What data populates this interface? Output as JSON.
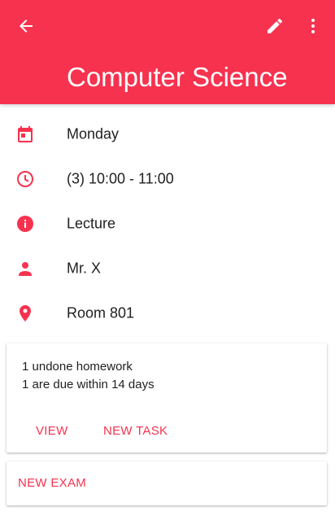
{
  "colors": {
    "accent": "#f7324f",
    "text": "#212121",
    "on_accent": "#ffffff"
  },
  "toolbar": {
    "title": "Computer Science",
    "back_icon": "arrow-back-icon",
    "edit_icon": "pencil-icon",
    "more_icon": "more-vertical-icon"
  },
  "details": [
    {
      "icon": "calendar-icon",
      "text": "Monday"
    },
    {
      "icon": "clock-icon",
      "text": "(3) 10:00 - 11:00"
    },
    {
      "icon": "info-icon",
      "text": "Lecture"
    },
    {
      "icon": "person-icon",
      "text": "Mr. X"
    },
    {
      "icon": "location-pin-icon",
      "text": "Room 801"
    }
  ],
  "homework_card": {
    "line1": "1 undone homework",
    "line2": "1 are due within 14 days",
    "view_label": "VIEW",
    "new_task_label": "NEW TASK"
  },
  "exam_card": {
    "new_exam_label": "NEW EXAM"
  }
}
